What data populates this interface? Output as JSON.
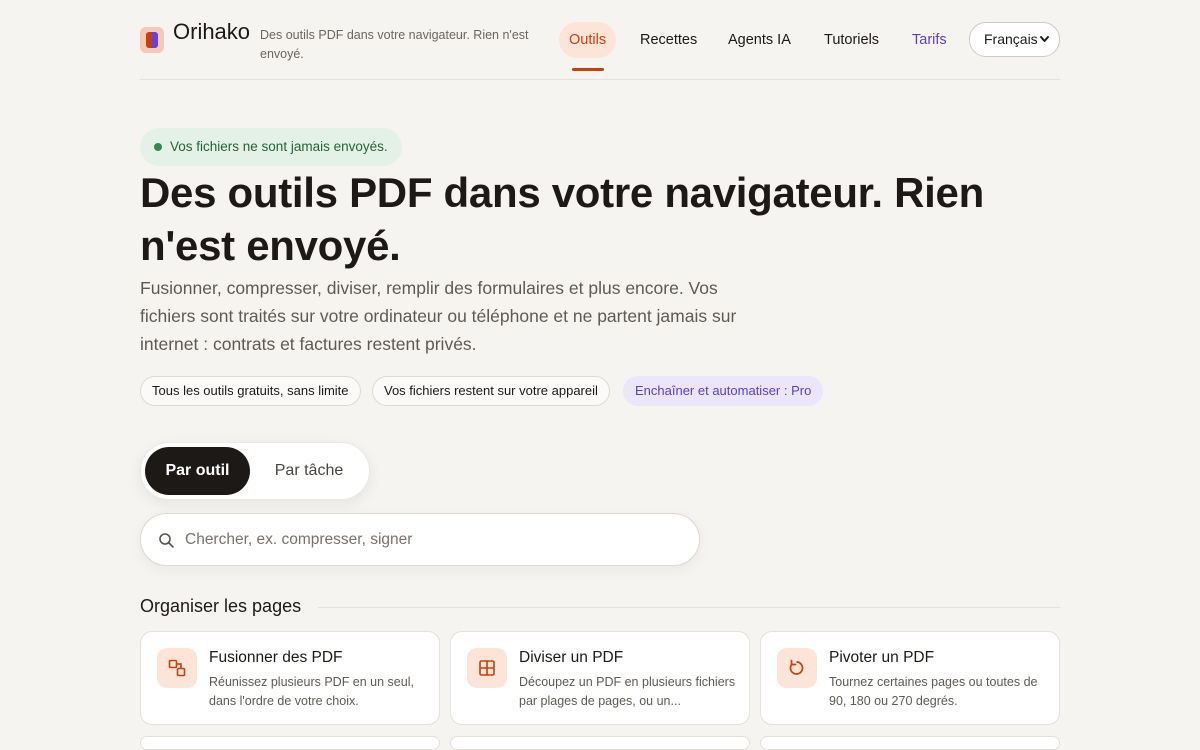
{
  "header": {
    "brand": "Orihako",
    "tagline": "Des outils PDF dans votre navigateur. Rien n'est envoyé.",
    "nav": [
      {
        "label": "Outils",
        "active": true
      },
      {
        "label": "Recettes"
      },
      {
        "label": "Agents IA"
      },
      {
        "label": "Tutoriels"
      },
      {
        "label": "Tarifs"
      }
    ],
    "language": "Français"
  },
  "hero": {
    "badge": "Vos fichiers ne sont jamais envoyés.",
    "title": "Des outils PDF dans votre navigateur. Rien n'est envoyé.",
    "subtitle": "Fusionner, compresser, diviser, remplir des formulaires et plus encore. Vos fichiers sont traités sur votre ordinateur ou téléphone et ne partent jamais sur internet : contrats et factures restent privés.",
    "pills": [
      "Tous les outils gratuits, sans limite",
      "Vos fichiers restent sur votre appareil",
      "Enchaîner et automatiser : Pro"
    ]
  },
  "view_toggle": {
    "options": [
      "Par outil",
      "Par tâche"
    ],
    "selected": "Par outil"
  },
  "search": {
    "placeholder": "Chercher, ex. compresser, signer",
    "value": ""
  },
  "sections": [
    {
      "title": "Organiser les pages",
      "tools": [
        {
          "title": "Fusionner des PDF",
          "description": "Réunissez plusieurs PDF en un seul, dans l'ordre de votre choix.",
          "icon": "merge-icon"
        },
        {
          "title": "Diviser un PDF",
          "description": "Découpez un PDF en plusieurs fichiers par plages de pages, ou un...",
          "icon": "split-icon"
        },
        {
          "title": "Pivoter un PDF",
          "description": "Tournez certaines pages ou toutes de 90, 180 ou 270 degrés.",
          "icon": "rotate-icon"
        }
      ]
    }
  ],
  "colors": {
    "accent": "#c2410c",
    "accent_soft": "#fde4d9",
    "pro": "#5b3fc4",
    "success": "#2f8a4f",
    "background": "#f6f4f1"
  }
}
